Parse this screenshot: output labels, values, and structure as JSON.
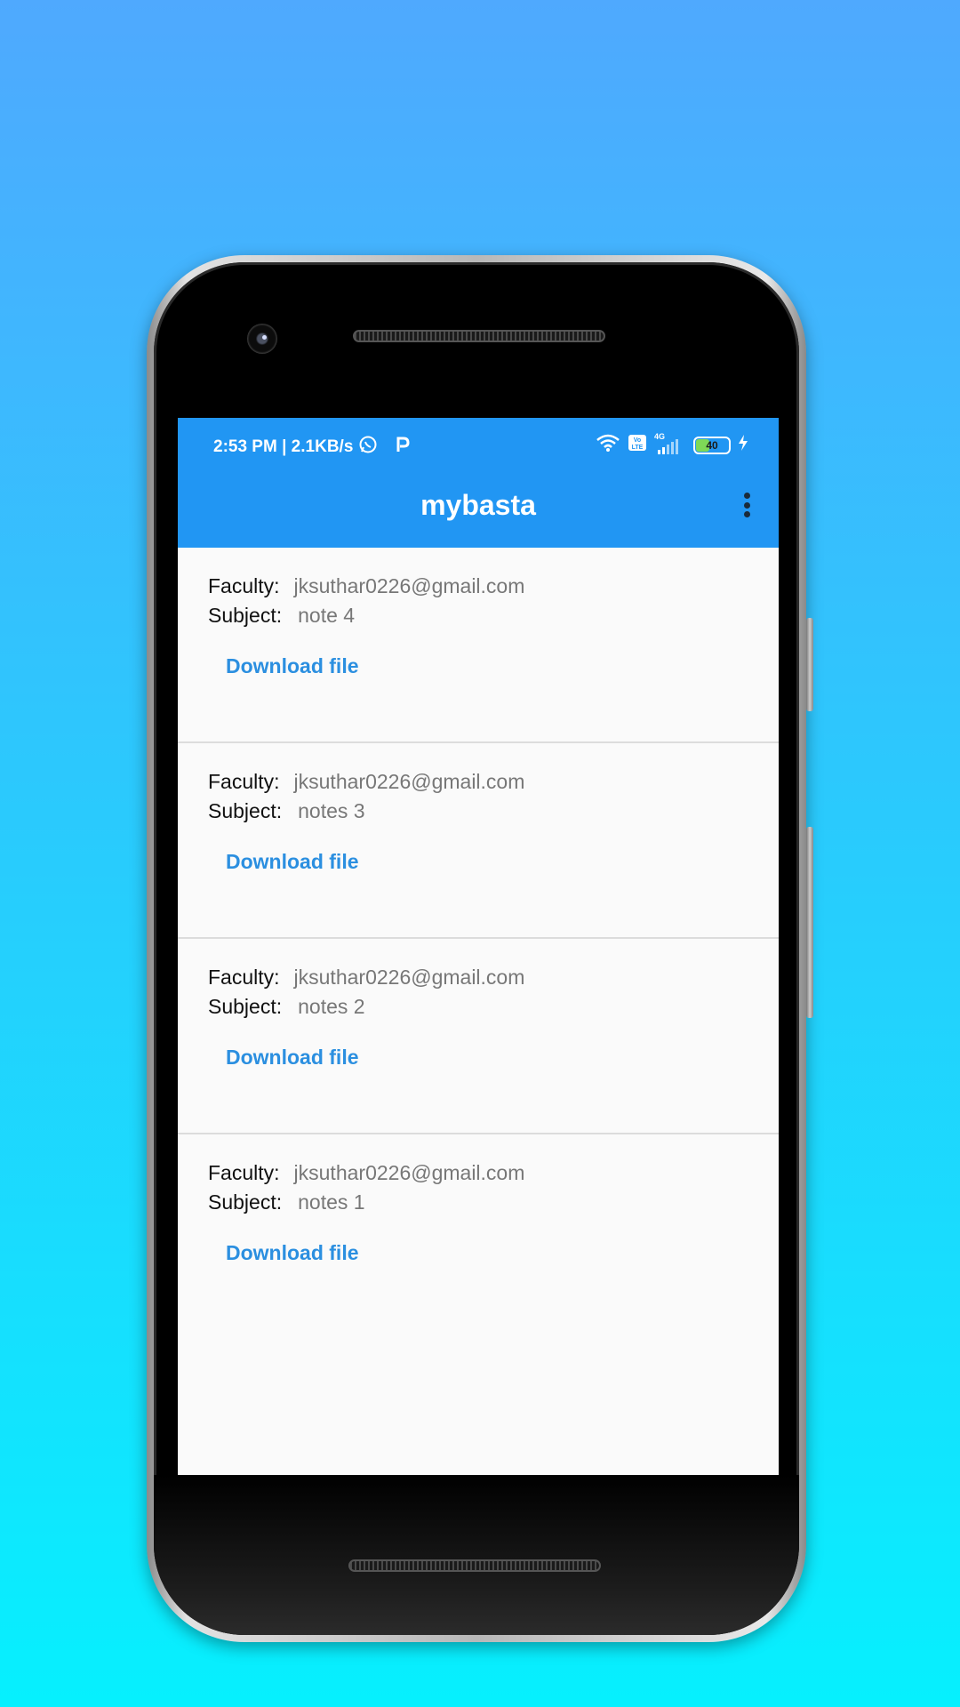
{
  "status_bar": {
    "time_speed": "2:53 PM | 2.1KB/s",
    "network_label": "4G",
    "battery_level": "40",
    "icons": [
      "whatsapp-icon",
      "paytm-icon",
      "wifi-icon",
      "volte-icon",
      "signal-icon",
      "battery-icon",
      "charging-icon"
    ]
  },
  "appbar": {
    "title": "mybasta",
    "menu_icon": "more-vert-icon"
  },
  "notes": [
    {
      "faculty_label": "Faculty:",
      "faculty": "jksuthar0226@gmail.com",
      "subject_label": "Subject:",
      "subject": "note 4",
      "action": "Download file"
    },
    {
      "faculty_label": "Faculty:",
      "faculty": "jksuthar0226@gmail.com",
      "subject_label": "Subject:",
      "subject": "notes 3",
      "action": "Download file"
    },
    {
      "faculty_label": "Faculty:",
      "faculty": "jksuthar0226@gmail.com",
      "subject_label": "Subject:",
      "subject": "notes 2",
      "action": "Download file"
    },
    {
      "faculty_label": "Faculty:",
      "faculty": "jksuthar0226@gmail.com",
      "subject_label": "Subject:",
      "subject": "notes 1",
      "action": "Download file"
    }
  ],
  "colors": {
    "primary": "#2196f3",
    "link": "#2b8fe0",
    "background_top": "#4fa9fe",
    "background_bottom": "#06f0fe"
  }
}
